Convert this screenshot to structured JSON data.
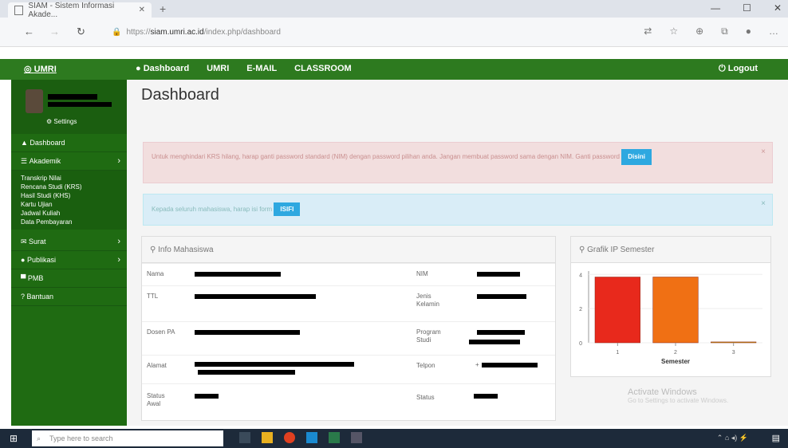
{
  "browser": {
    "tab_title": "SIAM - Sistem Informasi Akade...",
    "url_host": "siam.umri.ac.id",
    "url_prefix": "https://",
    "url_path": "/index.php/dashboard"
  },
  "topnav": {
    "brand": "UMRI",
    "items": [
      "Dashboard",
      "UMRI",
      "E-MAIL",
      "CLASSROOM"
    ],
    "logout": "Logout"
  },
  "sidebar": {
    "settings": "Settings",
    "items": [
      {
        "label": "Dashboard"
      },
      {
        "label": "Akademik"
      }
    ],
    "akademik_sub": [
      "Transkrip Nilai",
      "Rencana Studi (KRS)",
      "Hasil Studi (KHS)",
      "Kartu Ujian",
      "Jadwal Kuliah",
      "Data Pembayaran"
    ],
    "more": [
      {
        "label": "Surat"
      },
      {
        "label": "Publikasi"
      },
      {
        "label": "PMB"
      },
      {
        "label": "Bantuan"
      }
    ]
  },
  "main": {
    "title": "Dashboard",
    "alert_danger_text": "Untuk menghindari KRS hilang, harap ganti password standard (NIM) dengan password pilihan anda. Jangan membuat password sama dengan NIM. Ganti password",
    "alert_danger_btn": "Disini",
    "alert_info_text": "Kepada seluruh mahasiswa, harap isi form",
    "alert_info_btn": "ISIFI"
  },
  "info": {
    "title": "Info Mahasiswa",
    "labels_left": [
      "Nama",
      "TTL",
      "Dosen PA",
      "Alamat",
      "Status Awal"
    ],
    "labels_right": [
      "NIM",
      "Jenis Kelamin",
      "Program Studi",
      "Telpon",
      "Status"
    ],
    "telpon_prefix": "+"
  },
  "grafik": {
    "title": "Grafik IP Semester",
    "bar_colors": [
      "#e8291c",
      "#f07014",
      "#c8a010"
    ]
  },
  "chart_data": {
    "type": "bar",
    "categories": [
      "1",
      "2",
      "3"
    ],
    "values": [
      3.85,
      3.85,
      0.05
    ],
    "yticks": [
      "0",
      "2",
      "4"
    ],
    "ylim": [
      0,
      4.2
    ],
    "xlabel": "Semester"
  },
  "watermark": {
    "line1": "Activate Windows",
    "line2": "Go to Settings to activate Windows."
  },
  "taskbar": {
    "search": "Type here to search"
  }
}
